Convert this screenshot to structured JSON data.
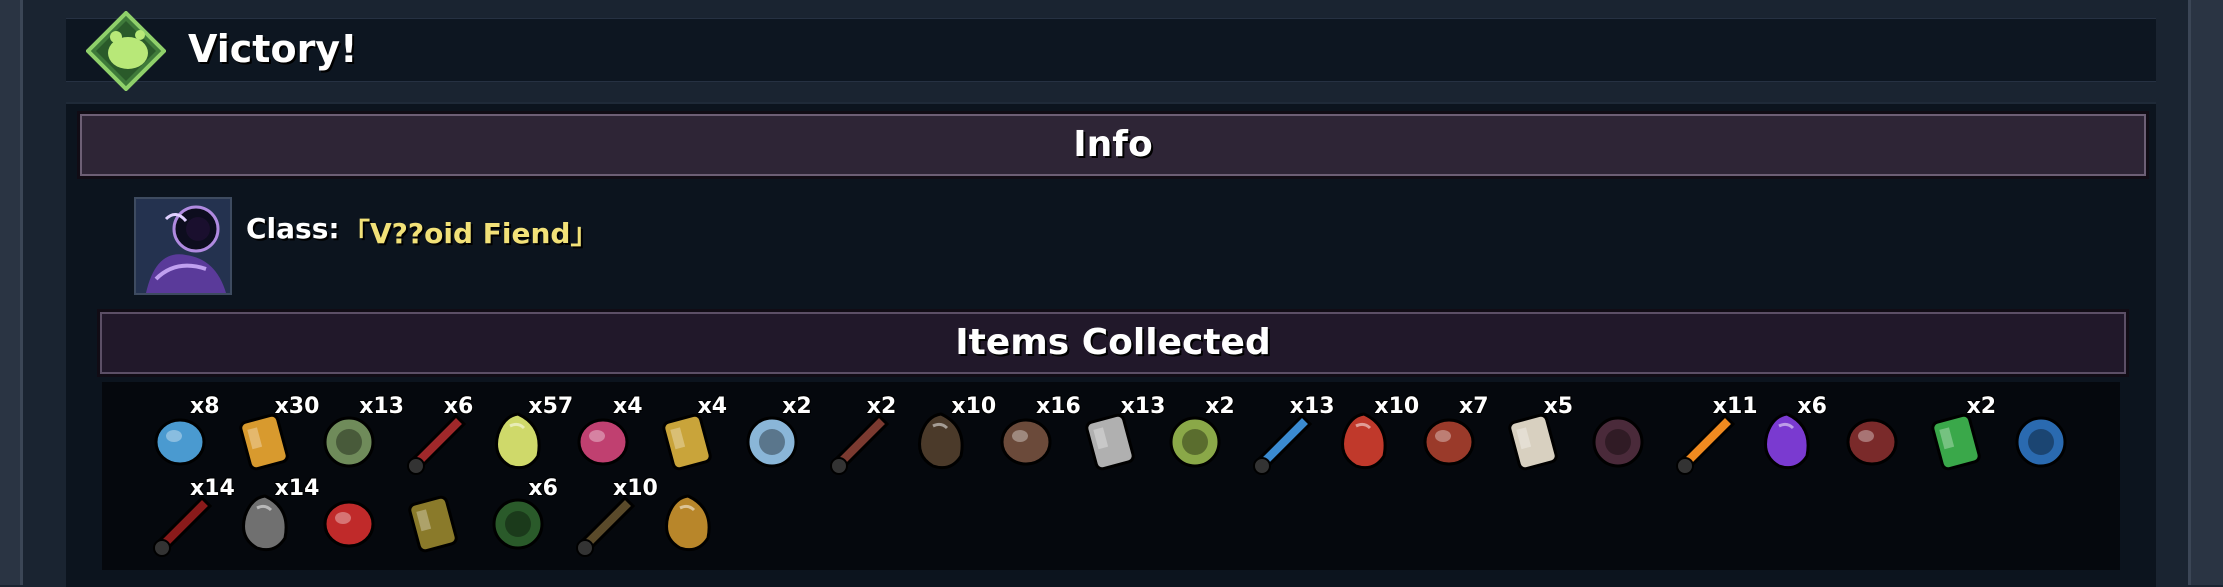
{
  "header": {
    "title": "Victory!",
    "logo_icon": "green-diamond-blob-icon"
  },
  "info": {
    "heading": "Info",
    "class_label": "Class:",
    "class_value": "「V??oid Fiend」",
    "portrait_icon": "void-fiend-portrait-icon"
  },
  "items_section": {
    "heading": "Items Collected",
    "items": [
      {
        "icon": "blue-turtle-icon",
        "count": "x8",
        "color": "#4a9ad0"
      },
      {
        "icon": "amber-beetle-icon",
        "count": "x30",
        "color": "#d89a2e"
      },
      {
        "icon": "green-jar-icon",
        "count": "x13",
        "color": "#6f8b5a"
      },
      {
        "icon": "red-book-icon",
        "count": "x6",
        "color": "#a0282a"
      },
      {
        "icon": "syringe-icon",
        "count": "x57",
        "color": "#cfd96a"
      },
      {
        "icon": "purple-crystal-icon",
        "count": "x4",
        "color": "#c04070"
      },
      {
        "icon": "gold-coin-icon",
        "count": "x4",
        "color": "#c9a43a"
      },
      {
        "icon": "silver-ring-icon",
        "count": "x2",
        "color": "#8ab6d8"
      },
      {
        "icon": "leather-belt-icon",
        "count": "x2",
        "color": "#7b3a30"
      },
      {
        "icon": "guitar-icon",
        "count": "x10",
        "color": "#4b3a2a"
      },
      {
        "icon": "teddy-bear-icon",
        "count": "x16",
        "color": "#6b4a3a"
      },
      {
        "icon": "black-tentacle-icon",
        "count": "x13",
        "color": "#b0b0b0"
      },
      {
        "icon": "hanging-seed-icon",
        "count": "x2",
        "color": "#8aa848"
      },
      {
        "icon": "blue-feather-icon",
        "count": "x13",
        "color": "#3a8ad0"
      },
      {
        "icon": "sunglasses-icon",
        "count": "x10",
        "color": "#c0392b"
      },
      {
        "icon": "red-mohawk-icon",
        "count": "x7",
        "color": "#9a3a2a"
      },
      {
        "icon": "bandage-roll-icon",
        "count": "x5",
        "color": "#d8d0c0"
      },
      {
        "icon": "dark-egg-icon",
        "count": "",
        "color": "#4a2a3a"
      },
      {
        "icon": "orange-lollipop-icon",
        "count": "x11",
        "color": "#f08a20"
      },
      {
        "icon": "purple-card-icon",
        "count": "x6",
        "color": "#7a3ad0"
      },
      {
        "icon": "coiled-spring-icon",
        "count": "",
        "color": "#7a2a2a"
      },
      {
        "icon": "green-sword-icon",
        "count": "x2",
        "color": "#3aa84a"
      },
      {
        "icon": "void-drone-icon",
        "count": "",
        "color": "#2a6ab0"
      },
      {
        "icon": "blood-cup-icon",
        "count": "x14",
        "color": "#8a1a1a"
      },
      {
        "icon": "grey-gauntlet-icon",
        "count": "x14",
        "color": "#707070"
      },
      {
        "icon": "fuel-canister-icon",
        "count": "",
        "color": "#c02a2a"
      },
      {
        "icon": "gold-gear-icon",
        "count": "",
        "color": "#8a7a2a"
      },
      {
        "icon": "green-boot-icon",
        "count": "x6",
        "color": "#2a5a2a"
      },
      {
        "icon": "brown-bag-icon",
        "count": "x10",
        "color": "#5a4a2a"
      },
      {
        "icon": "gold-idol-icon",
        "count": "",
        "color": "#b8862a"
      }
    ]
  }
}
